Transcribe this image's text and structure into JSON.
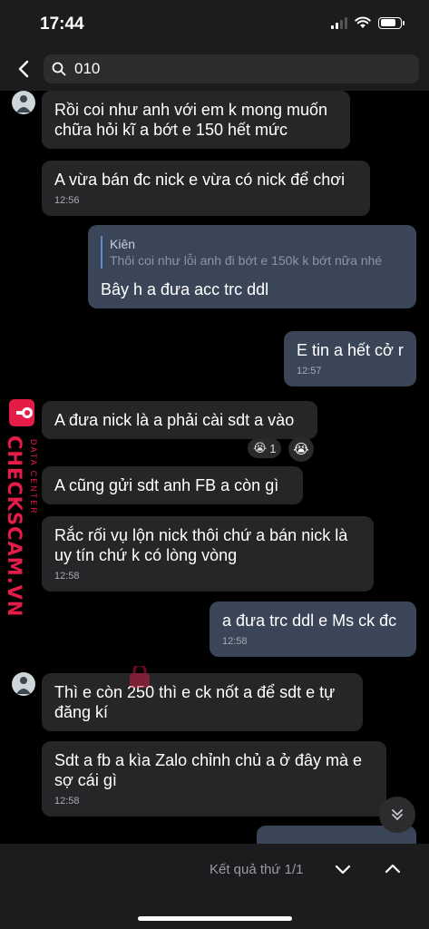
{
  "status_bar": {
    "time": "17:44"
  },
  "search": {
    "value": "010"
  },
  "messages": [
    {
      "text": "Rồi coi như anh với em k mong muốn chữa hỏi kĩ a bớt e 150 hết mức",
      "time": ""
    },
    {
      "text": "A vừa bán đc nick e vừa có nick để chơi",
      "time": "12:56"
    },
    {
      "quote_name": "Kiên",
      "quote_text": "Thôi coi như lỗi anh đi bớt e 150k k bớt nữa nhé",
      "text": "Bây h a đưa acc trc ddl"
    },
    {
      "text": "E tin a hết cở r",
      "time": "12:57"
    },
    {
      "text": "A đưa nick là a phải cài sdt a vào",
      "reaction_count": "1"
    },
    {
      "text": "A cũng gửi sdt anh FB a còn gì"
    },
    {
      "text": "Rắc rối vụ lộn nick thôi chứ a bán nick là uy tín chứ k có lòng vòng",
      "time": "12:58"
    },
    {
      "text": "a đưa trc ddl e Ms ck đc",
      "time": "12:58"
    },
    {
      "text": "Thì e còn 250 thì e ck nốt a để sdt e tự đăng kí"
    },
    {
      "text": "Sdt a fb a kìa Zalo chỉnh chủ a ở đây mà e sợ cái gì",
      "time": "12:58"
    }
  ],
  "watermark": {
    "brand": "CHECKSCAM.VN",
    "sub": "DATA CENTER"
  },
  "bottom_bar": {
    "result": "Kết quả thứ 1/1"
  },
  "icons": {
    "back": "chevron-left-icon",
    "search": "search-icon",
    "scroll_down": "double-chevron-down-icon",
    "prev": "chevron-down-icon",
    "next": "chevron-up-icon"
  },
  "colors": {
    "incoming_bubble": "#262628",
    "outgoing_bubble": "#3a4657",
    "watermark": "#e51c47"
  }
}
